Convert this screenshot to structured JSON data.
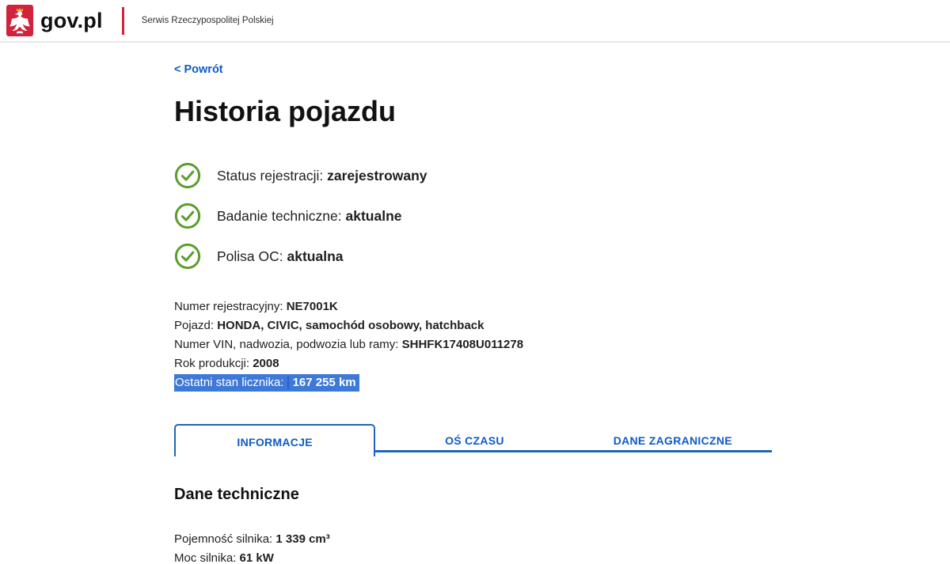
{
  "header": {
    "brand": "gov.pl",
    "tagline": "Serwis Rzeczypospolitej Polskiej"
  },
  "page": {
    "back_link": "< Powrót",
    "title": "Historia pojazdu"
  },
  "statuses": [
    {
      "label": "Status rejestracji:",
      "value": "zarejestrowany"
    },
    {
      "label": "Badanie techniczne:",
      "value": "aktualne"
    },
    {
      "label": "Polisa OC:",
      "value": "aktualna"
    }
  ],
  "details": [
    {
      "label": "Numer rejestracyjny:",
      "value": "NE7001K"
    },
    {
      "label": "Pojazd:",
      "value": "HONDA, CIVIC, samochód osobowy, hatchback"
    },
    {
      "label": "Numer VIN, nadwozia, podwozia lub ramy:",
      "value": "SHHFK17408U011278"
    },
    {
      "label": "Rok produkcji:",
      "value": "2008"
    },
    {
      "label": "Ostatni stan licznika:",
      "value": "167 255 km",
      "selected": true
    }
  ],
  "tabs": [
    {
      "label": "INFORMACJE",
      "active": true
    },
    {
      "label": "OŚ CZASU",
      "active": false
    },
    {
      "label": "DANE ZAGRANICZNE",
      "active": false
    }
  ],
  "technical": {
    "heading": "Dane techniczne",
    "rows": [
      {
        "label": "Pojemność silnika:",
        "value": "1 339 cm³"
      },
      {
        "label": "Moc silnika:",
        "value": "61 kW"
      }
    ]
  },
  "colors": {
    "link_blue": "#0c5bc8",
    "tab_border_blue": "#1f66b8",
    "check_green": "#5c9e2e",
    "brand_red": "#d2233c",
    "selection_blue": "#3d79d9",
    "selection_divider_blue": "#2d62c3"
  }
}
